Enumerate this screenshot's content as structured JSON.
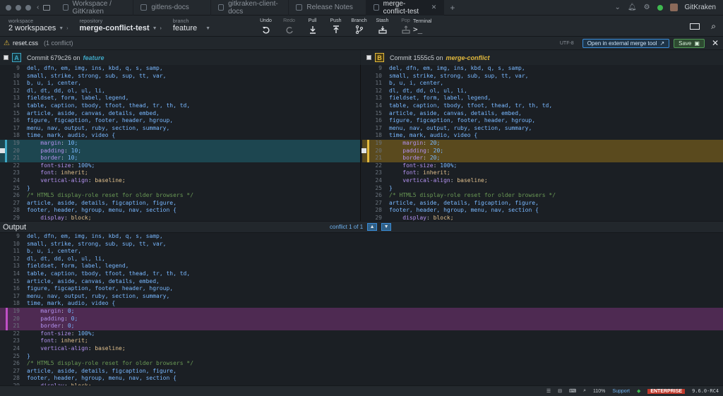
{
  "titlebar": {
    "tabs": [
      {
        "label": "Workspace / GitKraken",
        "active": false
      },
      {
        "label": "gitlens-docs",
        "active": false
      },
      {
        "label": "gitkraken-client-docs",
        "active": false
      },
      {
        "label": "Release Notes",
        "active": false
      },
      {
        "label": "merge-conflict-test",
        "active": true
      }
    ],
    "new_tab": "+",
    "user": "GitKraken"
  },
  "toolbar": {
    "workspace_caption": "workspace",
    "workspace_value": "2 workspaces",
    "repository_caption": "repository",
    "repository_value": "merge-conflict-test",
    "branch_caption": "branch",
    "branch_value": "feature",
    "actions": [
      "Undo",
      "Redo",
      "Pull",
      "Push",
      "Branch",
      "Stash",
      "Pop"
    ],
    "terminal": "Terminal"
  },
  "filebar": {
    "filename": "reset.css",
    "conflicts": "(1 conflict)",
    "encoding": "UTF-8",
    "external_label": "Open in external merge tool",
    "save_label": "Save"
  },
  "pane_a": {
    "badge": "A",
    "commit": "Commit 679c26 on",
    "branch": "feature",
    "color": "#3fa7c5"
  },
  "pane_b": {
    "badge": "B",
    "commit": "Commit 1555c5 on",
    "branch": "merge-conflict",
    "color": "#e2b93d"
  },
  "output": {
    "label": "Output",
    "nav": "conflict 1 of 1"
  },
  "code_common_top": [
    {
      "n": "9",
      "t": "del, dfn, em, img, ins, kbd, q, s, samp,"
    },
    {
      "n": "10",
      "t": "small, strike, strong, sub, sup, tt, var,"
    },
    {
      "n": "11",
      "t": "b, u, i, center,"
    },
    {
      "n": "12",
      "t": "dl, dt, dd, ol, ul, li,"
    },
    {
      "n": "13",
      "t": "fieldset, form, label, legend,"
    },
    {
      "n": "14",
      "t": "table, caption, tbody, tfoot, thead, tr, th, td,"
    },
    {
      "n": "15",
      "t": "article, aside, canvas, details, embed,"
    },
    {
      "n": "16",
      "t": "figure, figcaption, footer, header, hgroup,"
    },
    {
      "n": "17",
      "t": "menu, nav, output, ruby, section, summary,"
    },
    {
      "n": "18",
      "t": "time, mark, audio, video {"
    }
  ],
  "code_a_conflict": [
    {
      "n": "19",
      "p": "margin",
      "v": "10;"
    },
    {
      "n": "20",
      "p": "padding",
      "v": "10;"
    },
    {
      "n": "21",
      "p": "border",
      "v": "10;"
    }
  ],
  "code_b_conflict": [
    {
      "n": "19",
      "p": "margin",
      "v": "20;"
    },
    {
      "n": "20",
      "p": "padding",
      "v": "20;"
    },
    {
      "n": "21",
      "p": "border",
      "v": "20;"
    }
  ],
  "code_o_conflict": [
    {
      "n": "19",
      "p": "margin",
      "v": "0;"
    },
    {
      "n": "20",
      "p": "padding",
      "v": "0;"
    },
    {
      "n": "21",
      "p": "border",
      "v": "0;"
    }
  ],
  "code_common_bottom": [
    {
      "n": "22",
      "p": "font-size",
      "v": "100%;"
    },
    {
      "n": "23",
      "p": "font",
      "v": "inherit;"
    },
    {
      "n": "24",
      "p": "vertical-align",
      "v": "baseline;"
    },
    {
      "n": "25",
      "t": "}"
    },
    {
      "n": "26",
      "c": "/* HTML5 display-role reset for older browsers */"
    },
    {
      "n": "27",
      "t": "article, aside, details, figcaption, figure,"
    },
    {
      "n": "28",
      "t": "footer, header, hgroup, menu, nav, section {"
    },
    {
      "n": "29",
      "p": "display",
      "v": "block;"
    }
  ],
  "status": {
    "zoom": "110%",
    "support": "Support",
    "license": "ENTERPRISE",
    "version": "9.6.0-RC4"
  },
  "colors": {
    "accent": "#3a8dd8",
    "a": "#3fa7c5",
    "b": "#e2b93d",
    "output": "#c04fc7"
  }
}
